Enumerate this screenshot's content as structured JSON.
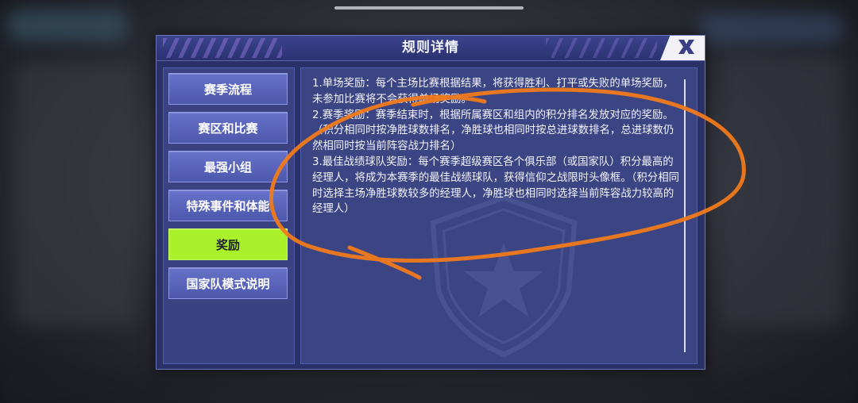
{
  "dialog": {
    "title": "规则详情",
    "close_icon": "close-x-icon"
  },
  "sidebar": {
    "items": [
      {
        "label": "赛季流程",
        "active": false
      },
      {
        "label": "赛区和比赛",
        "active": false
      },
      {
        "label": "最强小组",
        "active": false
      },
      {
        "label": "特殊事件和体能",
        "active": false
      },
      {
        "label": "奖励",
        "active": true
      },
      {
        "label": "国家队模式说明",
        "active": false
      }
    ]
  },
  "content": {
    "rules": [
      "1.单场奖励：每个主场比赛根据结果，将获得胜利、打平或失败的单场奖励，未参加比赛将不会获得单场奖励。",
      "2.赛季奖励：赛季结束时，根据所属赛区和组内的积分排名发放对应的奖励。（积分相同时按净胜球数排名，净胜球也相同时按总进球数排名，总进球数仍然相同时按当前阵容战力排名）",
      "3.最佳战绩球队奖励：每个赛季超级赛区各个俱乐部（或国家队）积分最高的经理人，将成为本赛季的最佳战绩球队，获得信仰之战限时头像框。（积分相同时选择主场净胜球数较多的经理人，净胜球也相同时选择当前阵容战力较高的经理人）"
    ]
  },
  "colors": {
    "active_tab": "#aaf12b",
    "annotation_stroke": "#f07a1a"
  }
}
